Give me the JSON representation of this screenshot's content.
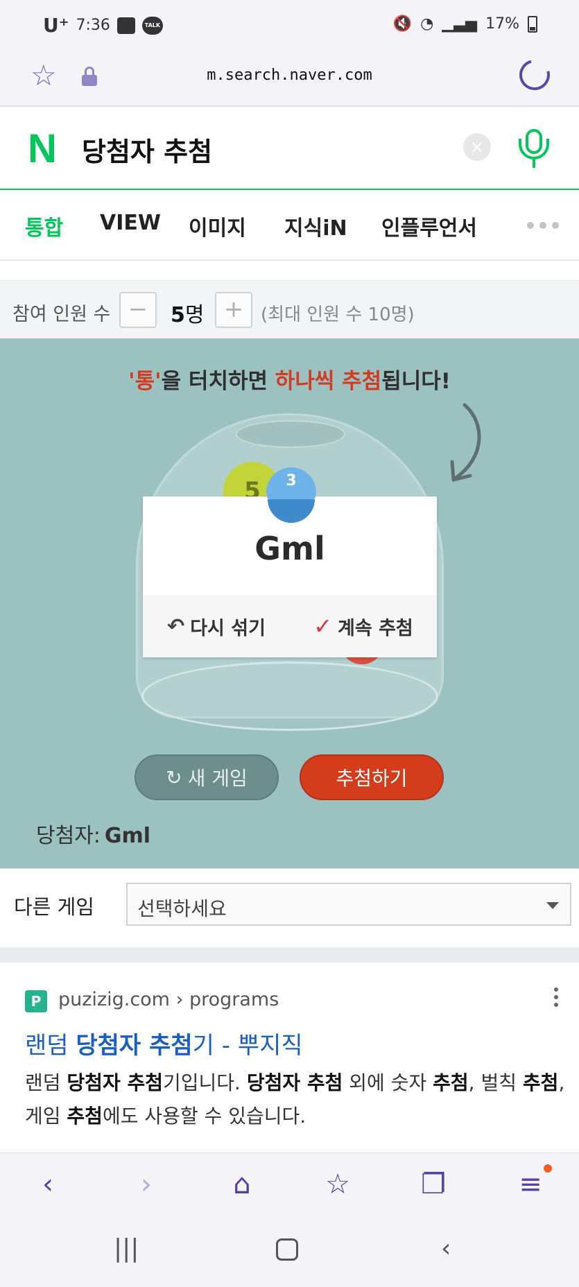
{
  "status_bar": {
    "carrier": "U⁺",
    "time": "7:36",
    "talk_badge": "TALK",
    "battery": "17%"
  },
  "browser": {
    "url": "m.search.naver.com"
  },
  "search": {
    "query": "당첨자 추첨",
    "logo": "N"
  },
  "tabs": [
    "통합",
    "VIEW",
    "이미지",
    "지식iN",
    "인플루언서"
  ],
  "participants": {
    "label": "참여 인원 수",
    "minus": "−",
    "plus": "+",
    "count": "5",
    "unit": "명",
    "max_text": "(최대 인원 수 10명)"
  },
  "game": {
    "instruction_quote1": "'통'",
    "instruction_mid": "을 터치하면 ",
    "instruction_red": "하나씩 추첨",
    "instruction_end": "됩니다!",
    "ball_green_number": "5",
    "ball_blue_number": "3",
    "result_name": "Gml",
    "reshuffle_label": "다시 섞기",
    "continue_label": "계속 추첨",
    "new_game_label": "새 게임",
    "draw_label": "추첨하기",
    "winner_label": "당첨자:",
    "winner_value": "Gml"
  },
  "other_game": {
    "label": "다른 게임",
    "select_value": "선택하세요"
  },
  "result": {
    "favicon": "P",
    "site": "puzizig.com › programs",
    "title_pre": "랜덤 ",
    "title_bold": "당첨자 추첨",
    "title_post": "기 - 뿌지직",
    "desc_html_parts": [
      "랜덤 ",
      "당첨자 추첨",
      "기입니다. ",
      "당첨자 추첨",
      " 외에 숫자 ",
      "추첨",
      ", 벌칙 ",
      "추첨",
      ", 게임 ",
      "추첨",
      "에도 사용할 수 있습니다."
    ]
  },
  "colors": {
    "naver_green": "#03c75a",
    "game_bg": "#9bc1c1",
    "draw_red": "#d33d1c",
    "link_blue": "#1a5fc2",
    "nav_purple": "#5440a8"
  },
  "icons": {
    "bookmark": "star-icon",
    "secure": "lock-icon",
    "reload": "reload-icon",
    "clear": "clear-icon",
    "voice": "mic-icon",
    "back": "back-icon",
    "forward": "forward-icon",
    "home": "home-icon",
    "favorites": "favorites-icon",
    "tabs": "tabs-icon",
    "menu": "menu-icon"
  }
}
